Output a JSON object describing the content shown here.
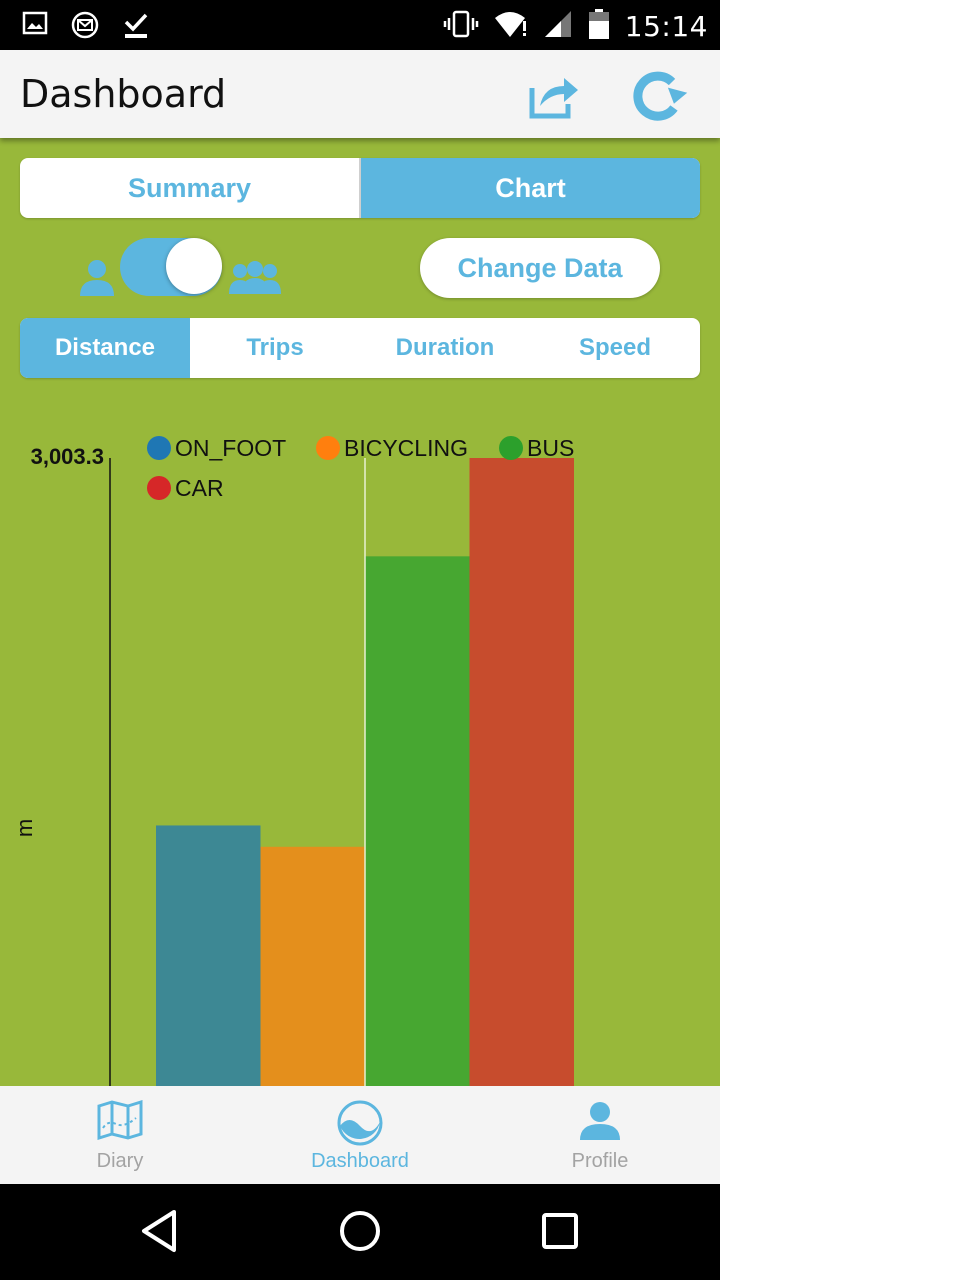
{
  "status_bar": {
    "time": "15:14",
    "left_icons": [
      "image-icon",
      "mail-icon",
      "download-done-icon"
    ],
    "right_icons": [
      "vibrate-icon",
      "wifi-icon",
      "signal-icon",
      "battery-icon"
    ]
  },
  "app_bar": {
    "title": "Dashboard",
    "actions": [
      "share-icon",
      "refresh-icon"
    ]
  },
  "view_switch": {
    "options": [
      "Summary",
      "Chart"
    ],
    "selected": "Chart"
  },
  "toggle": {
    "left_icon": "person-icon",
    "right_icon": "group-icon",
    "state": "on"
  },
  "change_data_label": "Change Data",
  "metric_tabs": {
    "items": [
      "Distance",
      "Trips",
      "Duration",
      "Speed"
    ],
    "selected": "Distance"
  },
  "chart_data": {
    "type": "bar",
    "categories": [
      "ON_FOOT",
      "BICYCLING",
      "BUS",
      "CAR"
    ],
    "values": [
      1246,
      1144,
      2533,
      3003.3
    ],
    "max_label": "3,003.3",
    "ylabel": "m",
    "ylim": [
      0,
      3003.3
    ],
    "legend": [
      {
        "name": "ON_FOOT",
        "color": "#1f77b4"
      },
      {
        "name": "BICYCLING",
        "color": "#ff7f0e"
      },
      {
        "name": "BUS",
        "color": "#2ca02c"
      },
      {
        "name": "CAR",
        "color": "#d62728"
      }
    ],
    "bar_colors": [
      "#3d8894",
      "#e48f1c",
      "#47a731",
      "#c74c2d"
    ],
    "legend_placement": "top"
  },
  "bottom_nav": {
    "items": [
      {
        "label": "Diary",
        "icon": "map-icon"
      },
      {
        "label": "Dashboard",
        "icon": "dashboard-icon"
      },
      {
        "label": "Profile",
        "icon": "profile-icon"
      }
    ],
    "selected": "Dashboard"
  },
  "system_nav": [
    "back-icon",
    "home-icon",
    "recents-icon"
  ],
  "colors": {
    "accent": "#5cb6df",
    "background_green": "#98b83a",
    "status_bar": "#000000"
  }
}
